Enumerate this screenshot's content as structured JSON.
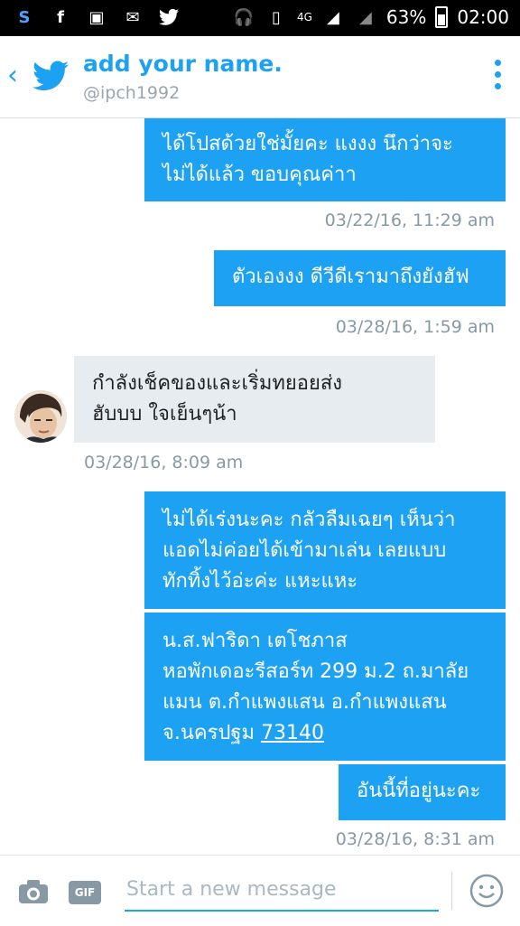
{
  "status_bar": {
    "battery": "63%",
    "time": "02:00",
    "network": "4G"
  },
  "header": {
    "title": "add your name.",
    "handle": "@ipch1992"
  },
  "messages": [
    {
      "type": "sent",
      "lines": [
        "ได้โปสด้วยใช่มั้ยคะ แงงง นึกว่าจะ",
        "ไม่ได้แล้ว ขอบคุณค่าา"
      ]
    },
    {
      "type": "time",
      "text": "03/22/16, 11:29 am"
    },
    {
      "type": "sent",
      "lines": [
        "ตัวเองงง ดีวีดีเรามาถึงยังฮัฟ"
      ]
    },
    {
      "type": "time",
      "text": "03/28/16, 1:59 am"
    },
    {
      "type": "received",
      "lines": [
        "กำลังเช็คของและเริ่มทยอยส่ง",
        "ฮับบบ ใจเย็นๆน้า"
      ]
    },
    {
      "type": "time",
      "text": "03/28/16, 8:09 am"
    },
    {
      "type": "sent",
      "lines": [
        "ไม่ได้เร่งนะคะ กลัวลืมเฉยๆ เห็นว่า",
        "แอดไม่ค่อยได้เข้ามาเล่น เลยแบบ",
        "ทักทิ้งไว้อ่ะค่ะ แหะแหะ"
      ]
    },
    {
      "type": "sent",
      "lines": [
        "น.ส.ฟาริดา เตโชภาส",
        "หอพักเดอะรีสอร์ท 299 ม.2 ถ.มาลัย",
        "แมน ต.กำแพงแสน อ.กำแพงแสน",
        "จ.นครปฐม "
      ],
      "link": "73140"
    },
    {
      "type": "sent",
      "lines": [
        "อันนี้ที่อยู่นะคะ"
      ]
    },
    {
      "type": "time",
      "text": "03/28/16, 8:31 am"
    }
  ],
  "compose": {
    "placeholder": "Start a new message",
    "gif_label": "GIF"
  }
}
